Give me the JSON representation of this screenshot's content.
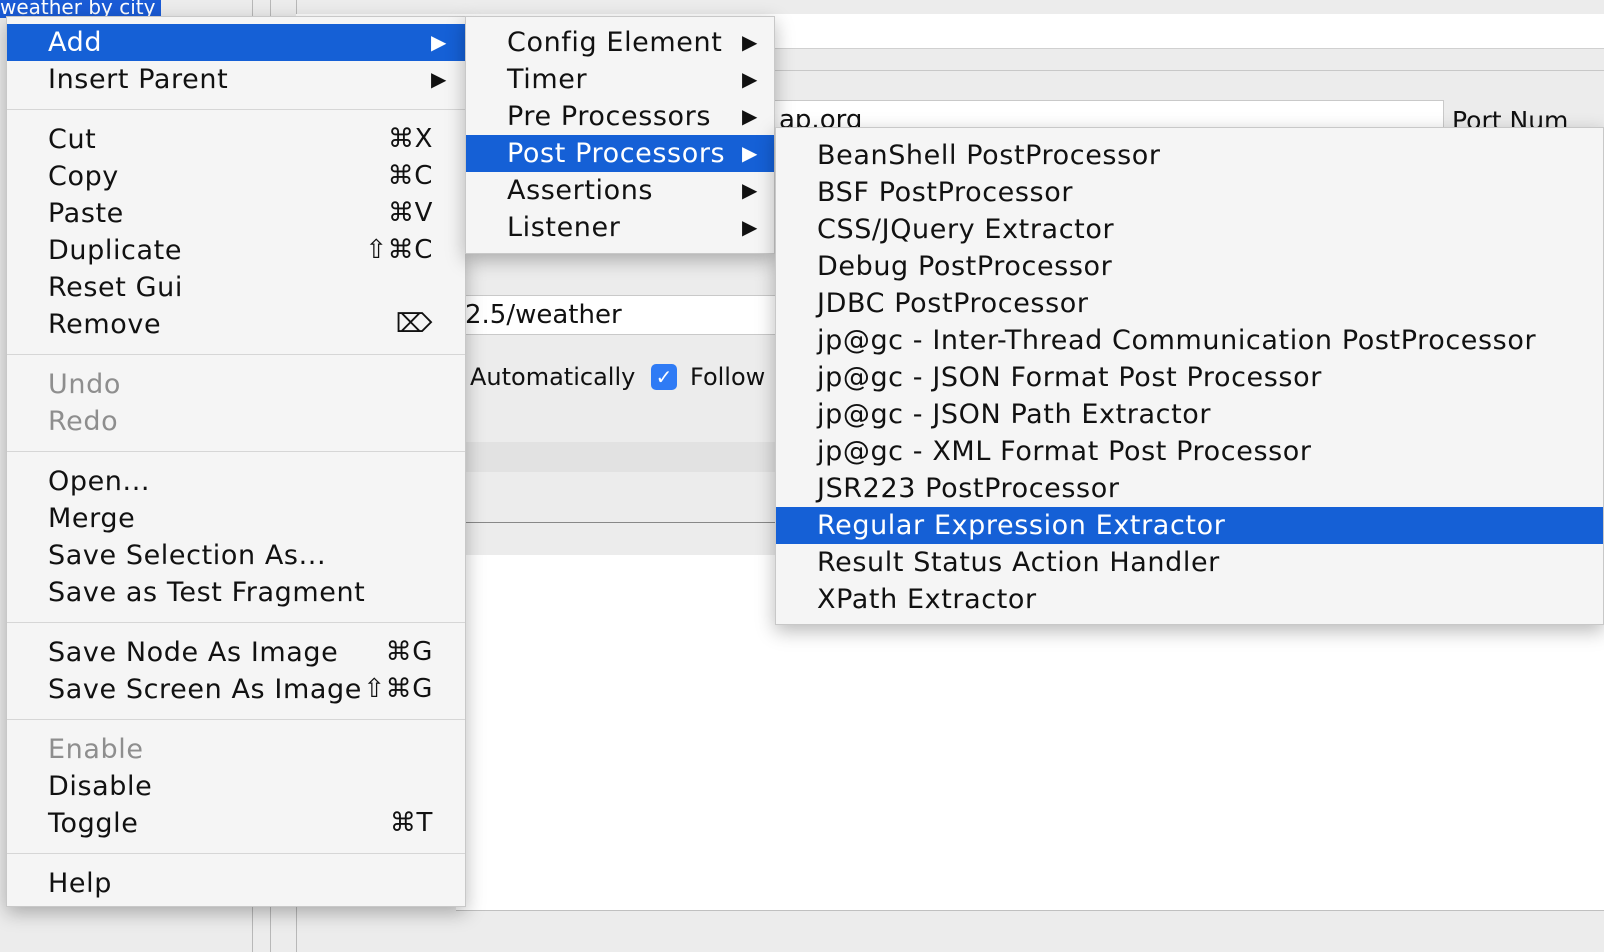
{
  "background": {
    "tree_selected_label": "weather by city",
    "server_field_value": "ap.org",
    "port_label": "Port Num",
    "path_field_value": "2.5/weather",
    "redirect_auto_label": "Automatically",
    "follow_redirects_label": "Follow R",
    "follow_redirects_checked": true
  },
  "context_menu": {
    "items": [
      {
        "label": "Add",
        "shortcut": "",
        "submenu": true,
        "selected": true,
        "disabled": false
      },
      {
        "label": "Insert Parent",
        "shortcut": "",
        "submenu": true,
        "selected": false,
        "disabled": false
      },
      {
        "separator": true
      },
      {
        "label": "Cut",
        "shortcut": "⌘X"
      },
      {
        "label": "Copy",
        "shortcut": "⌘C"
      },
      {
        "label": "Paste",
        "shortcut": "⌘V"
      },
      {
        "label": "Duplicate",
        "shortcut": "⇧⌘C"
      },
      {
        "label": "Reset Gui",
        "shortcut": ""
      },
      {
        "label": "Remove",
        "shortcut": "⌦"
      },
      {
        "separator": true
      },
      {
        "label": "Undo",
        "shortcut": "",
        "disabled": true
      },
      {
        "label": "Redo",
        "shortcut": "",
        "disabled": true
      },
      {
        "separator": true
      },
      {
        "label": "Open...",
        "shortcut": ""
      },
      {
        "label": "Merge",
        "shortcut": ""
      },
      {
        "label": "Save Selection As...",
        "shortcut": ""
      },
      {
        "label": "Save as Test Fragment",
        "shortcut": ""
      },
      {
        "separator": true
      },
      {
        "label": "Save Node As Image",
        "shortcut": "⌘G"
      },
      {
        "label": "Save Screen As Image",
        "shortcut": "⇧⌘G"
      },
      {
        "separator": true
      },
      {
        "label": "Enable",
        "shortcut": "",
        "disabled": true
      },
      {
        "label": "Disable",
        "shortcut": ""
      },
      {
        "label": "Toggle",
        "shortcut": "⌘T"
      },
      {
        "separator": true
      },
      {
        "label": "Help",
        "shortcut": ""
      }
    ]
  },
  "add_submenu": {
    "items": [
      {
        "label": "Config Element",
        "submenu": true,
        "selected": false
      },
      {
        "label": "Timer",
        "submenu": true,
        "selected": false
      },
      {
        "label": "Pre Processors",
        "submenu": true,
        "selected": false
      },
      {
        "label": "Post Processors",
        "submenu": true,
        "selected": true
      },
      {
        "label": "Assertions",
        "submenu": true,
        "selected": false
      },
      {
        "label": "Listener",
        "submenu": true,
        "selected": false
      }
    ]
  },
  "post_processors_submenu": {
    "items": [
      {
        "label": "BeanShell PostProcessor",
        "selected": false
      },
      {
        "label": "BSF PostProcessor",
        "selected": false
      },
      {
        "label": "CSS/JQuery Extractor",
        "selected": false
      },
      {
        "label": "Debug PostProcessor",
        "selected": false
      },
      {
        "label": "JDBC PostProcessor",
        "selected": false
      },
      {
        "label": "jp@gc - Inter-Thread Communication PostProcessor",
        "selected": false
      },
      {
        "label": "jp@gc - JSON Format Post Processor",
        "selected": false
      },
      {
        "label": "jp@gc - JSON Path Extractor",
        "selected": false
      },
      {
        "label": "jp@gc - XML Format Post Processor",
        "selected": false
      },
      {
        "label": "JSR223 PostProcessor",
        "selected": false
      },
      {
        "label": "Regular Expression Extractor",
        "selected": true
      },
      {
        "label": "Result Status Action Handler",
        "selected": false
      },
      {
        "label": "XPath Extractor",
        "selected": false
      }
    ]
  },
  "colors": {
    "selection": "#1560d6",
    "menu_bg": "#f5f5f5",
    "disabled_text": "#8e8e8e",
    "checkbox": "#2f7bf5"
  }
}
